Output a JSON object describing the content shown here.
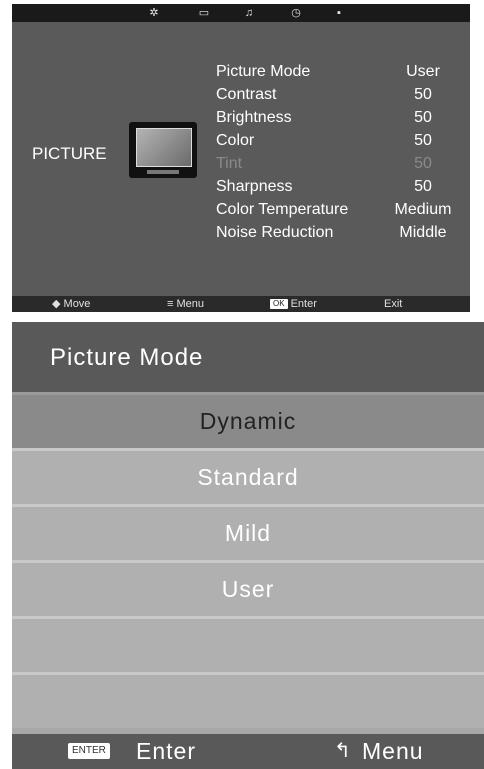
{
  "osd": {
    "tabs": [
      {
        "name": "sun-icon",
        "glyph": "✲"
      },
      {
        "name": "monitor-icon",
        "glyph": "▭"
      },
      {
        "name": "music-note-icon",
        "glyph": "♫"
      },
      {
        "name": "clock-icon",
        "glyph": "◷"
      },
      {
        "name": "grid-icon",
        "glyph": "▪"
      }
    ],
    "section_title": "PICTURE",
    "items": [
      {
        "label": "Picture Mode",
        "value": "User",
        "enabled": true
      },
      {
        "label": "Contrast",
        "value": "50",
        "enabled": true
      },
      {
        "label": "Brightness",
        "value": "50",
        "enabled": true
      },
      {
        "label": "Color",
        "value": "50",
        "enabled": true
      },
      {
        "label": "Tint",
        "value": "50",
        "enabled": false
      },
      {
        "label": "Sharpness",
        "value": "50",
        "enabled": true
      },
      {
        "label": "Color Temperature",
        "value": "Medium",
        "enabled": true
      },
      {
        "label": "Noise Reduction",
        "value": "Middle",
        "enabled": true
      }
    ],
    "footer": {
      "move": {
        "icon": "◆",
        "label": "Move"
      },
      "menu": {
        "icon": "≡",
        "label": "Menu"
      },
      "enter": {
        "key": "OK",
        "label": "Enter"
      },
      "exit": {
        "label": "Exit"
      }
    }
  },
  "submenu": {
    "title": "Picture Mode",
    "options": [
      {
        "label": "Dynamic",
        "selected": true
      },
      {
        "label": "Standard",
        "selected": false
      },
      {
        "label": "Mild",
        "selected": false
      },
      {
        "label": "User",
        "selected": false
      },
      {
        "label": "",
        "selected": false
      },
      {
        "label": "",
        "selected": false
      }
    ],
    "footer": {
      "enter_key": "ENTER",
      "enter_label": "Enter",
      "back_glyph": "↰",
      "menu_label": "Menu"
    }
  }
}
